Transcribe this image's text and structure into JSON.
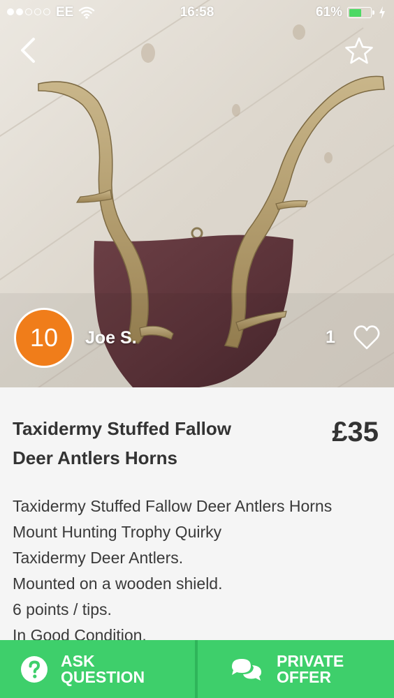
{
  "status_bar": {
    "carrier": "EE",
    "time": "16:58",
    "battery_percent": "61%",
    "battery_level": 0.61,
    "signal_bars": 2,
    "signal_total": 5
  },
  "nav": {
    "back_icon": "chevron-left-icon",
    "favorite_icon": "star-outline-icon"
  },
  "seller": {
    "badge": "10",
    "name": "Joe S."
  },
  "likes": {
    "count": "1",
    "icon": "heart-outline-icon"
  },
  "listing": {
    "title_line1": "Taxidermy Stuffed Fallow",
    "title_line2": "Deer Antlers Horns",
    "price": "£35",
    "description": [
      "Taxidermy Stuffed Fallow Deer Antlers Horns",
      "Mount Hunting Trophy Quirky",
      "Taxidermy Deer Antlers.",
      "Mounted on a wooden shield.",
      "6 points / tips.",
      "In Good Condition."
    ]
  },
  "actions": {
    "ask_line1": "ASK",
    "ask_line2": "QUESTION",
    "offer_line1": "PRIVATE",
    "offer_line2": "OFFER"
  },
  "colors": {
    "accent_green": "#3ecf6b",
    "avatar_orange": "#f07d1a",
    "battery_green": "#4cd964"
  }
}
